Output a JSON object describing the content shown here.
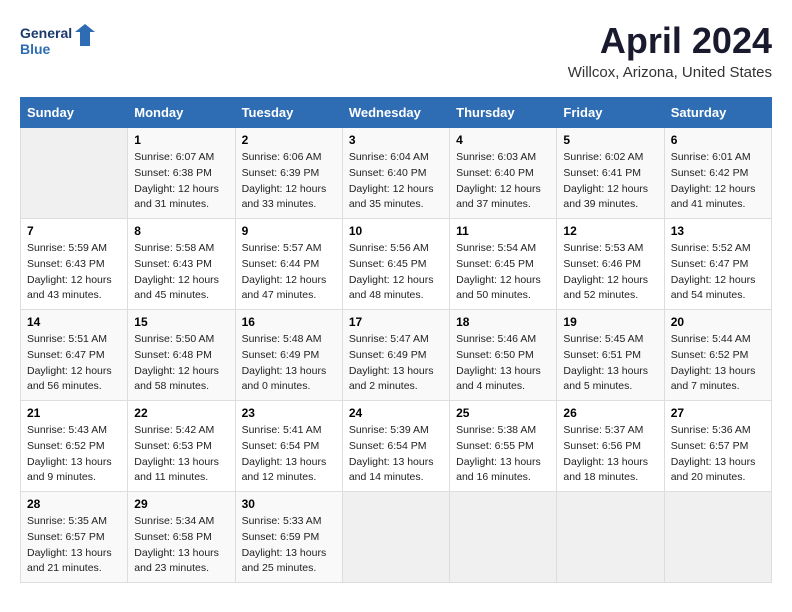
{
  "logo": {
    "line1": "General",
    "line2": "Blue"
  },
  "title": "April 2024",
  "subtitle": "Willcox, Arizona, United States",
  "days_header": [
    "Sunday",
    "Monday",
    "Tuesday",
    "Wednesday",
    "Thursday",
    "Friday",
    "Saturday"
  ],
  "weeks": [
    [
      {
        "num": "",
        "info": ""
      },
      {
        "num": "1",
        "info": "Sunrise: 6:07 AM\nSunset: 6:38 PM\nDaylight: 12 hours\nand 31 minutes."
      },
      {
        "num": "2",
        "info": "Sunrise: 6:06 AM\nSunset: 6:39 PM\nDaylight: 12 hours\nand 33 minutes."
      },
      {
        "num": "3",
        "info": "Sunrise: 6:04 AM\nSunset: 6:40 PM\nDaylight: 12 hours\nand 35 minutes."
      },
      {
        "num": "4",
        "info": "Sunrise: 6:03 AM\nSunset: 6:40 PM\nDaylight: 12 hours\nand 37 minutes."
      },
      {
        "num": "5",
        "info": "Sunrise: 6:02 AM\nSunset: 6:41 PM\nDaylight: 12 hours\nand 39 minutes."
      },
      {
        "num": "6",
        "info": "Sunrise: 6:01 AM\nSunset: 6:42 PM\nDaylight: 12 hours\nand 41 minutes."
      }
    ],
    [
      {
        "num": "7",
        "info": "Sunrise: 5:59 AM\nSunset: 6:43 PM\nDaylight: 12 hours\nand 43 minutes."
      },
      {
        "num": "8",
        "info": "Sunrise: 5:58 AM\nSunset: 6:43 PM\nDaylight: 12 hours\nand 45 minutes."
      },
      {
        "num": "9",
        "info": "Sunrise: 5:57 AM\nSunset: 6:44 PM\nDaylight: 12 hours\nand 47 minutes."
      },
      {
        "num": "10",
        "info": "Sunrise: 5:56 AM\nSunset: 6:45 PM\nDaylight: 12 hours\nand 48 minutes."
      },
      {
        "num": "11",
        "info": "Sunrise: 5:54 AM\nSunset: 6:45 PM\nDaylight: 12 hours\nand 50 minutes."
      },
      {
        "num": "12",
        "info": "Sunrise: 5:53 AM\nSunset: 6:46 PM\nDaylight: 12 hours\nand 52 minutes."
      },
      {
        "num": "13",
        "info": "Sunrise: 5:52 AM\nSunset: 6:47 PM\nDaylight: 12 hours\nand 54 minutes."
      }
    ],
    [
      {
        "num": "14",
        "info": "Sunrise: 5:51 AM\nSunset: 6:47 PM\nDaylight: 12 hours\nand 56 minutes."
      },
      {
        "num": "15",
        "info": "Sunrise: 5:50 AM\nSunset: 6:48 PM\nDaylight: 12 hours\nand 58 minutes."
      },
      {
        "num": "16",
        "info": "Sunrise: 5:48 AM\nSunset: 6:49 PM\nDaylight: 13 hours\nand 0 minutes."
      },
      {
        "num": "17",
        "info": "Sunrise: 5:47 AM\nSunset: 6:49 PM\nDaylight: 13 hours\nand 2 minutes."
      },
      {
        "num": "18",
        "info": "Sunrise: 5:46 AM\nSunset: 6:50 PM\nDaylight: 13 hours\nand 4 minutes."
      },
      {
        "num": "19",
        "info": "Sunrise: 5:45 AM\nSunset: 6:51 PM\nDaylight: 13 hours\nand 5 minutes."
      },
      {
        "num": "20",
        "info": "Sunrise: 5:44 AM\nSunset: 6:52 PM\nDaylight: 13 hours\nand 7 minutes."
      }
    ],
    [
      {
        "num": "21",
        "info": "Sunrise: 5:43 AM\nSunset: 6:52 PM\nDaylight: 13 hours\nand 9 minutes."
      },
      {
        "num": "22",
        "info": "Sunrise: 5:42 AM\nSunset: 6:53 PM\nDaylight: 13 hours\nand 11 minutes."
      },
      {
        "num": "23",
        "info": "Sunrise: 5:41 AM\nSunset: 6:54 PM\nDaylight: 13 hours\nand 12 minutes."
      },
      {
        "num": "24",
        "info": "Sunrise: 5:39 AM\nSunset: 6:54 PM\nDaylight: 13 hours\nand 14 minutes."
      },
      {
        "num": "25",
        "info": "Sunrise: 5:38 AM\nSunset: 6:55 PM\nDaylight: 13 hours\nand 16 minutes."
      },
      {
        "num": "26",
        "info": "Sunrise: 5:37 AM\nSunset: 6:56 PM\nDaylight: 13 hours\nand 18 minutes."
      },
      {
        "num": "27",
        "info": "Sunrise: 5:36 AM\nSunset: 6:57 PM\nDaylight: 13 hours\nand 20 minutes."
      }
    ],
    [
      {
        "num": "28",
        "info": "Sunrise: 5:35 AM\nSunset: 6:57 PM\nDaylight: 13 hours\nand 21 minutes."
      },
      {
        "num": "29",
        "info": "Sunrise: 5:34 AM\nSunset: 6:58 PM\nDaylight: 13 hours\nand 23 minutes."
      },
      {
        "num": "30",
        "info": "Sunrise: 5:33 AM\nSunset: 6:59 PM\nDaylight: 13 hours\nand 25 minutes."
      },
      {
        "num": "",
        "info": ""
      },
      {
        "num": "",
        "info": ""
      },
      {
        "num": "",
        "info": ""
      },
      {
        "num": "",
        "info": ""
      }
    ]
  ]
}
